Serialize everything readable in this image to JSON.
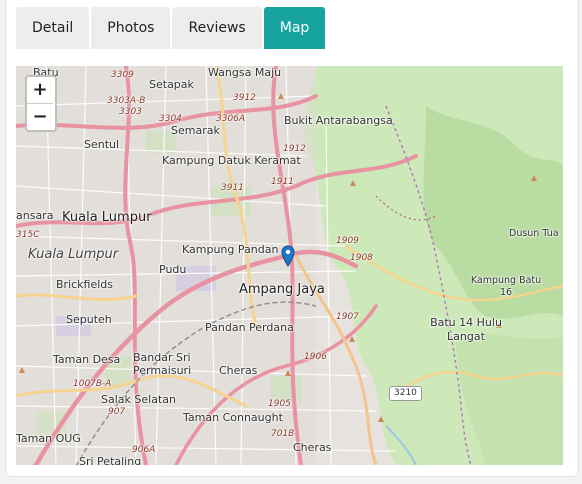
{
  "tabs": [
    {
      "label": "Detail",
      "active": false
    },
    {
      "label": "Photos",
      "active": false
    },
    {
      "label": "Reviews",
      "active": false
    },
    {
      "label": "Map",
      "active": true
    }
  ],
  "accent_color": "#17a4a0",
  "map": {
    "zoom_in": "+",
    "zoom_out": "−",
    "places": {
      "batu": "Batu",
      "wangsa_maju": "Wangsa Maju",
      "setapak": "Setapak",
      "semarak": "Semarak",
      "bukit_antarabangsa": "Bukit Antarabangsa",
      "sentul": "Sentul",
      "kampung_datuk_keramat": "Kampung Datuk Keramat",
      "kuala_lumpur": "Kuala Lumpur",
      "kuala_lumpur_italic": "Kuala Lumpur",
      "ansara": "ansara",
      "kampung_pandan": "Kampung Pandan",
      "pudu": "Pudu",
      "brickfields": "Brickfields",
      "ampang_jaya": "Ampang Jaya",
      "seputeh": "Seputeh",
      "pandan_perdana": "Pandan Perdana",
      "taman_desa": "Taman Desa",
      "bandar_sri_permaisuri": "Bandar Sri Permaisuri",
      "cheras": "Cheras",
      "salak_selatan": "Salak Selatan",
      "taman_connaught": "Taman Connaught",
      "taman_oug": "Taman OUG",
      "sri_petaling": "Sri Petaling",
      "cheras_south": "Cheras",
      "dusun_tua": "Dusun Tua",
      "kampung_batu_16": "Kampung Batu 16",
      "batu_14_hulu_langat": "Batu 14 Hulu Langat"
    },
    "roads": {
      "r3309": "3309",
      "r3303ab": "3303A-B",
      "r3303": "3303",
      "r3912": "3912",
      "r3304": "3304",
      "r3306a": "3306A",
      "r1912": "1912",
      "r3911": "3911",
      "r1911": "1911",
      "r315c": "315C",
      "r1909": "1909",
      "r1908": "1908",
      "r1907": "1907",
      "r1906": "1906",
      "r1007ab": "1007B-A",
      "r907": "907",
      "r1905": "1905",
      "r701b": "701B",
      "r906a": "906A",
      "r3210": "3210"
    }
  }
}
